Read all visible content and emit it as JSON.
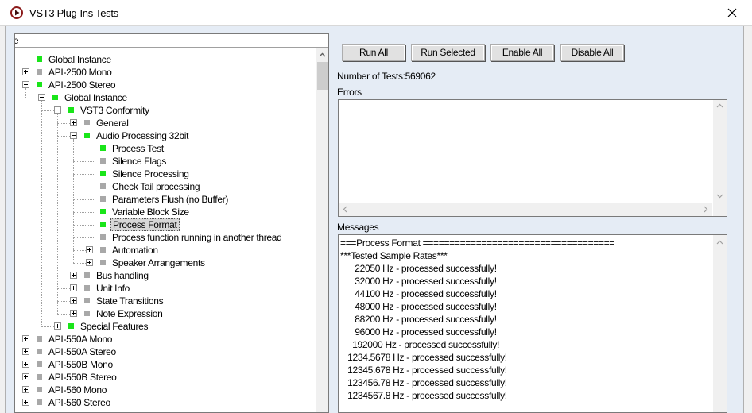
{
  "window": {
    "title": "VST3 Plug-Ins Tests",
    "close_icon": "close-icon",
    "app_icon": "vst-logo-icon"
  },
  "tree": {
    "header": "e",
    "nodes": [
      {
        "label": "Global Instance",
        "depth": 0,
        "expander": "none",
        "status": "pass"
      },
      {
        "label": "API-2500 Mono",
        "depth": 0,
        "expander": "plus",
        "status": "none"
      },
      {
        "label": "API-2500 Stereo",
        "depth": 0,
        "expander": "minus",
        "status": "pass"
      },
      {
        "label": "Global Instance",
        "depth": 1,
        "expander": "minus",
        "status": "pass"
      },
      {
        "label": "VST3 Conformity",
        "depth": 2,
        "expander": "minus",
        "status": "pass"
      },
      {
        "label": "General",
        "depth": 3,
        "expander": "plus",
        "status": "none"
      },
      {
        "label": "Audio Processing 32bit",
        "depth": 3,
        "expander": "minus",
        "status": "pass"
      },
      {
        "label": "Process Test",
        "depth": 4,
        "expander": "none",
        "status": "pass"
      },
      {
        "label": "Silence Flags",
        "depth": 4,
        "expander": "none",
        "status": "none"
      },
      {
        "label": "Silence Processing",
        "depth": 4,
        "expander": "none",
        "status": "pass"
      },
      {
        "label": "Check Tail processing",
        "depth": 4,
        "expander": "none",
        "status": "none"
      },
      {
        "label": "Parameters Flush (no Buffer)",
        "depth": 4,
        "expander": "none",
        "status": "none"
      },
      {
        "label": "Variable Block Size",
        "depth": 4,
        "expander": "none",
        "status": "pass"
      },
      {
        "label": "Process Format",
        "depth": 4,
        "expander": "none",
        "status": "pass",
        "selected": true
      },
      {
        "label": "Process function running in another thread",
        "depth": 4,
        "expander": "none",
        "status": "none"
      },
      {
        "label": "Automation",
        "depth": 4,
        "expander": "plus",
        "status": "none"
      },
      {
        "label": "Speaker Arrangements",
        "depth": 4,
        "expander": "plus",
        "status": "none"
      },
      {
        "label": "Bus handling",
        "depth": 3,
        "expander": "plus",
        "status": "none"
      },
      {
        "label": "Unit Info",
        "depth": 3,
        "expander": "plus",
        "status": "none"
      },
      {
        "label": "State Transitions",
        "depth": 3,
        "expander": "plus",
        "status": "none"
      },
      {
        "label": "Note Expression",
        "depth": 3,
        "expander": "plus",
        "status": "none"
      },
      {
        "label": "Special Features",
        "depth": 2,
        "expander": "plus",
        "status": "pass"
      },
      {
        "label": "API-550A Mono",
        "depth": 0,
        "expander": "plus",
        "status": "none"
      },
      {
        "label": "API-550A Stereo",
        "depth": 0,
        "expander": "plus",
        "status": "none"
      },
      {
        "label": "API-550B Mono",
        "depth": 0,
        "expander": "plus",
        "status": "none"
      },
      {
        "label": "API-550B Stereo",
        "depth": 0,
        "expander": "plus",
        "status": "none"
      },
      {
        "label": "API-560 Mono",
        "depth": 0,
        "expander": "plus",
        "status": "none"
      },
      {
        "label": "API-560 Stereo",
        "depth": 0,
        "expander": "plus",
        "status": "none"
      }
    ]
  },
  "toolbar": {
    "run_all": "Run All",
    "run_selected": "Run Selected",
    "enable_all": "Enable All",
    "disable_all": "Disable All"
  },
  "info": {
    "num_tests": "Number of Tests:569062",
    "errors_label": "Errors",
    "messages_label": "Messages"
  },
  "messages": [
    "===Process Format ====================================",
    "***Tested Sample Rates***",
    "      22050 Hz - processed successfully!",
    "      32000 Hz - processed successfully!",
    "      44100 Hz - processed successfully!",
    "      48000 Hz - processed successfully!",
    "      88200 Hz - processed successfully!",
    "      96000 Hz - processed successfully!",
    "     192000 Hz - processed successfully!",
    "   1234.5678 Hz - processed successfully!",
    "   12345.678 Hz - processed successfully!",
    "   123456.78 Hz - processed successfully!",
    "   1234567.8 Hz - processed successfully!"
  ],
  "colors": {
    "pass": "#19e519",
    "none": "#a8a8a8",
    "client_bg": "#e5ecf5"
  }
}
